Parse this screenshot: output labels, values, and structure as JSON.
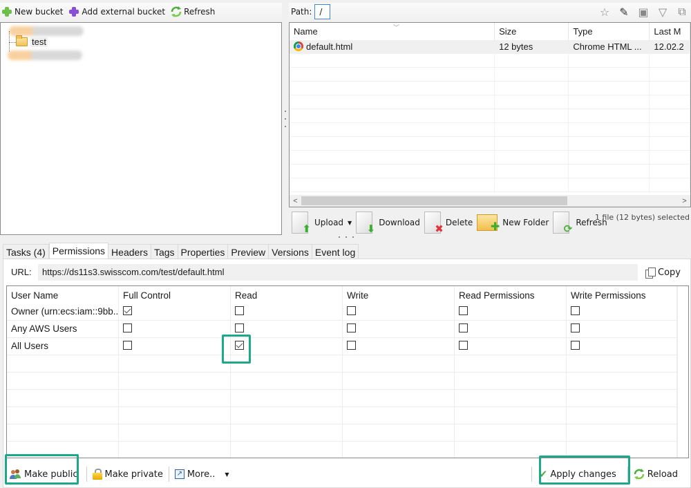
{
  "left_toolbar": {
    "new_bucket": "New bucket",
    "add_external_bucket": "Add external bucket",
    "refresh": "Refresh",
    "colors": {
      "new_bucket_icon": "#6cc04a",
      "add_external_icon": "#8a4fd6"
    }
  },
  "tree": {
    "items": [
      {
        "label": "test",
        "icon": "folder-icon"
      }
    ]
  },
  "path_bar": {
    "label": "Path:",
    "value": "/",
    "icons": [
      "star-icon",
      "pencil-icon",
      "window-icon",
      "filter-icon",
      "copy-icon"
    ]
  },
  "file_list": {
    "columns": [
      "Name",
      "Size",
      "Type",
      "Last M"
    ],
    "rows": [
      {
        "name": "default.html",
        "size": "12 bytes",
        "type": "Chrome HTML ...",
        "modified": "12.02.2",
        "icon": "chrome-icon"
      }
    ]
  },
  "file_toolbar": {
    "upload": "Upload",
    "download": "Download",
    "delete": "Delete",
    "new_folder": "New Folder",
    "refresh": "Refresh",
    "status": "1 file (12 bytes) selected"
  },
  "tabs": [
    {
      "label": "Tasks (4)",
      "active": false
    },
    {
      "label": "Permissions",
      "active": true
    },
    {
      "label": "Headers",
      "active": false
    },
    {
      "label": "Tags",
      "active": false
    },
    {
      "label": "Properties",
      "active": false
    },
    {
      "label": "Preview",
      "active": false
    },
    {
      "label": "Versions",
      "active": false
    },
    {
      "label": "Event log",
      "active": false
    }
  ],
  "permissions": {
    "url_label": "URL:",
    "url": "https://ds11s3.swisscom.com/test/default.html",
    "copy_label": "Copy",
    "columns": [
      "User Name",
      "Full Control",
      "Read",
      "Write",
      "Read Permissions",
      "Write Permissions"
    ],
    "rows": [
      {
        "user": "Owner (urn:ecs:iam::9bb...",
        "checks": [
          true,
          false,
          false,
          false,
          false
        ]
      },
      {
        "user": "Any AWS Users",
        "checks": [
          false,
          false,
          false,
          false,
          false
        ]
      },
      {
        "user": "All Users",
        "checks": [
          false,
          true,
          false,
          false,
          false
        ]
      }
    ],
    "toolbar": {
      "make_public": "Make public",
      "make_private": "Make private",
      "more": "More..",
      "apply_changes": "Apply changes",
      "reload": "Reload"
    },
    "highlight_color": "#1ba98a"
  }
}
